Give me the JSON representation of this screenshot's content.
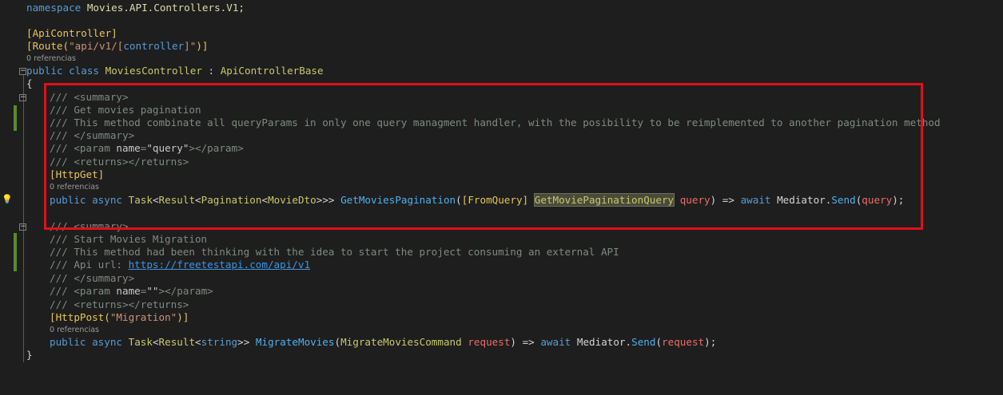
{
  "lines": {
    "namespace": {
      "kw": "namespace",
      "name": "Movies.API.Controllers.V1;"
    },
    "attr_api": "[ApiController]",
    "route": {
      "open": "[Route(",
      "str_a": "\"api/v1/[",
      "ctrl": "controller",
      "str_b": "]\"",
      "close": ")]"
    },
    "refs_class": "0 referencias",
    "class_decl": {
      "kw1": "public",
      "kw2": "class",
      "name": "MoviesController",
      "colon": " : ",
      "base": "ApiControllerBase"
    },
    "open_brace": "{",
    "close_brace": "}"
  },
  "method1": {
    "summary_open": "/// <summary>",
    "line1": "/// Get movies pagination",
    "line2": "/// This method combinate all queryParams in only one query managment handler, with the posibility to be reimplemented to another pagination method",
    "summary_close": "/// </summary>",
    "param": {
      "pre": "/// <param ",
      "attr": "name",
      "eq": "=",
      "val": "\"query\"",
      "post": "></param>"
    },
    "returns": "/// <returns></returns>",
    "http_attr": "[HttpGet]",
    "refs": "0 referencias",
    "sig": {
      "kw1": "public",
      "kw2": "async",
      "task": "Task",
      "lt1": "<",
      "result": "Result",
      "lt2": "<",
      "pagination": "Pagination",
      "lt3": "<",
      "dto": "MovieDto",
      "gt": ">>>",
      "fn": "GetMoviesPagination",
      "p_open": "(",
      "from_query": "[FromQuery]",
      "query_type": "GetMoviePaginationQuery",
      "param": "query",
      "arrow": ") =>",
      "await": "await",
      "mediator": "Mediator.",
      "send": "Send",
      "arg": "query",
      "end": ");"
    }
  },
  "method2": {
    "summary_open": "/// <summary>",
    "line1": "/// Start Movies Migration",
    "line2": "/// This method had been thinking with the idea to start the project consuming an external API",
    "api_prefix": "/// Api url: ",
    "api_link": "https://freetestapi.com/api/v1",
    "summary_close": "/// </summary>",
    "param": {
      "pre": "/// <param ",
      "attr": "name",
      "eq": "=",
      "val": "\"\"",
      "post": "></param>"
    },
    "returns": "/// <returns></returns>",
    "http_attr_open": "[HttpPost(",
    "http_attr_str": "\"Migration\"",
    "http_attr_close": ")]",
    "refs": "0 referencias",
    "sig": {
      "kw1": "public",
      "kw2": "async",
      "task": "Task",
      "lt1": "<",
      "result": "Result",
      "lt2": "<",
      "str": "string",
      "gt": ">>",
      "fn": "MigrateMovies",
      "p_open": "(",
      "cmd_type": "MigrateMoviesCommand",
      "param": "request",
      "arrow": ") =>",
      "await": "await",
      "mediator": "Mediator.",
      "send": "Send",
      "arg": "request",
      "end": ");"
    }
  },
  "colors": {
    "background": "#1e1e1e",
    "highlight_box": "#e0101a",
    "change_bar": "#5a8a2a"
  },
  "icons": [
    "lightbulb-icon",
    "fold-minus-icon"
  ]
}
